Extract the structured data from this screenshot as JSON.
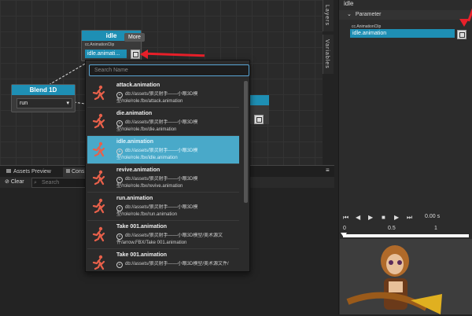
{
  "graph": {
    "idle_node": {
      "title": "idle",
      "field_label": "cc.AnimationClip",
      "field_value": "idle.animati...",
      "tooltip": "More"
    },
    "blend_node": {
      "title": "Blend 1D",
      "select_value": "run"
    },
    "right_tabs": [
      "Layers",
      "Variables"
    ]
  },
  "inspector": {
    "title": "idle",
    "section": "Parameter",
    "field_label": "cc.AnimationClip",
    "field_value": "idle.animation"
  },
  "bottom": {
    "tabs": [
      "Assets Preview",
      "Cons"
    ],
    "clear_label": "Clear",
    "search_placeholder": "Search"
  },
  "dropdown": {
    "search_placeholder": "Search Name",
    "items": [
      {
        "name": "attack.animation",
        "path": "db://assets/狼灵射手——小眼3D模型/role/role.fbx/attack.animation",
        "selected": false
      },
      {
        "name": "die.animation",
        "path": "db://assets/狼灵射手——小眼3D模型/role/role.fbx/die.animation",
        "selected": false
      },
      {
        "name": "idle.animation",
        "path": "db://assets/狼灵射手——小眼3D模型/role/role.fbx/idle.animation",
        "selected": true
      },
      {
        "name": "revive.animation",
        "path": "db://assets/狼灵射手——小眼3D模型/role/role.fbx/revive.animation",
        "selected": false
      },
      {
        "name": "run.animation",
        "path": "db://assets/狼灵射手——小眼3D模型/role/role.fbx/run.animation",
        "selected": false
      },
      {
        "name": "Take 001.animation",
        "path": "db://assets/狼灵射手——小眼3D模型/美术源文件/arrow.FBX/Take 001.animation",
        "selected": false
      },
      {
        "name": "Take 001.animation",
        "path": "db://assets/狼灵射手——小眼3D模型/美术源文件/",
        "selected": false
      }
    ]
  },
  "timeline": {
    "time": "0.00 s",
    "ticks": [
      "0",
      "0.5",
      "1"
    ]
  },
  "colors": {
    "accent": "#1e8fb4",
    "selected": "#49a9c9",
    "arrow": "#e8202a",
    "icon": "#e8604a"
  }
}
